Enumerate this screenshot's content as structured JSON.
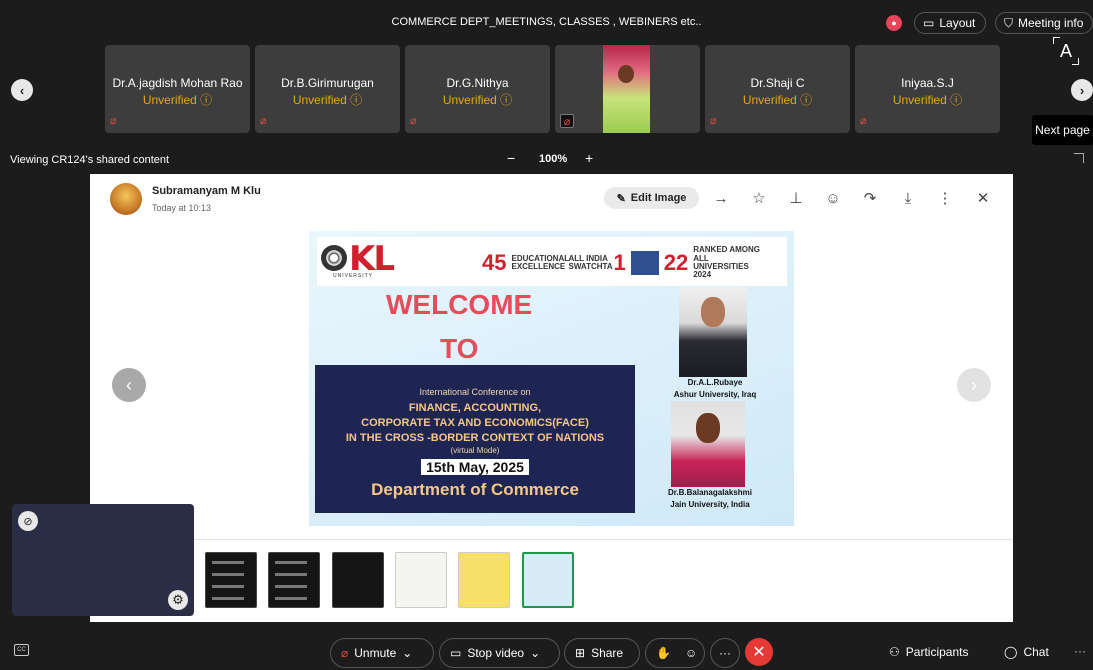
{
  "meeting": {
    "title": "COMMERCE DEPT_MEETINGS, CLASSES , WEBINERS etc..",
    "layout_label": "Layout",
    "meeting_info_label": "Meeting info"
  },
  "participants_strip": [
    {
      "name": "Dr.A.jagdish Mohan Rao",
      "status": "Unverified"
    },
    {
      "name": "Dr.B.Girimurugan",
      "status": "Unverified"
    },
    {
      "name": "Dr.G.Nithya",
      "status": "Unverified"
    },
    {
      "name": "",
      "status": ""
    },
    {
      "name": "Dr.Shaji C",
      "status": "Unverified"
    },
    {
      "name": "Iniyaa.S.J",
      "status": "Unverified"
    }
  ],
  "next_page_tooltip": "Next page",
  "share_bar": {
    "viewing_label": "Viewing CR124's shared content",
    "zoom_minus": "−",
    "zoom_value": "100%",
    "zoom_plus": "+"
  },
  "message": {
    "sender": "Subramanyam M Klu",
    "time": "Today at 10:13",
    "edit_label": "Edit Image"
  },
  "poster": {
    "logo_text": "KL",
    "logo_sub": "UNIVERSITY",
    "rank1_num": "45",
    "rank1_text": "EDUCATIONAL EXCELLENCE",
    "rank2_text": "ALL INDIA SWATCHTA",
    "rank2_num": "1",
    "rank3_num": "22",
    "rank3_text": "RANKED AMONG ALL UNIVERSITIES 2024",
    "welcome": "WELCOME",
    "to": "TO",
    "conf_line1": "International Conference on",
    "conf_line2": "FINANCE, ACCOUNTING,",
    "conf_line3": "CORPORATE TAX AND ECONOMICS(FACE)",
    "conf_line4": "IN THE CROSS -BORDER CONTEXT OF NATIONS",
    "conf_mode": "(virtual Mode)",
    "conf_date": "15th May, 2025",
    "conf_dept": "Department of Commerce",
    "speaker1_name": "Dr.A.L.Rubaye",
    "speaker1_affil": "Ashur University, Iraq",
    "speaker2_name": "Dr.B.Balanagalakshmi",
    "speaker2_affil": "Jain University, India"
  },
  "toolbar": {
    "unmute_label": "Unmute",
    "stop_video_label": "Stop video",
    "share_label": "Share",
    "participants_label": "Participants",
    "chat_label": "Chat"
  },
  "icons": {
    "mic_off": "mic-off-icon",
    "pin": "pin-icon",
    "gear": "gear-icon",
    "leave": "end-call-icon"
  },
  "colors": {
    "unverified": "#e6a817",
    "leave": "#e53935",
    "poster_title": "#e84c5b"
  }
}
